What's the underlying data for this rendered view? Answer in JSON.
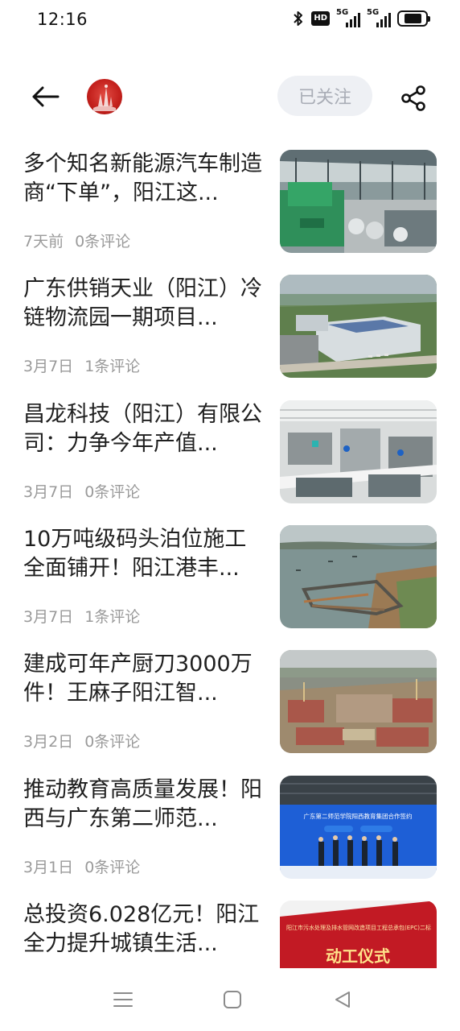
{
  "status_bar": {
    "time": "12:16",
    "icons": [
      "bluetooth-icon",
      "hd-voice-icon",
      "5g-signal-icon",
      "5g-signal-icon",
      "battery-icon"
    ],
    "hd_label": "HD",
    "signal_1_label": "5G",
    "signal_2_label": "5G",
    "battery_level": 0.7
  },
  "header": {
    "back_icon": "arrow-left-icon",
    "avatar": "publisher-logo",
    "follow_label": "已关注",
    "share_icon": "share-icon"
  },
  "news": [
    {
      "title": "多个知名新能源汽车制造商“下单”，阳江这...",
      "date": "7天前",
      "comments": "0条评论",
      "thumb": "factory-hall"
    },
    {
      "title": "广东供销天业（阳江）冷链物流园一期项目...",
      "date": "3月7日",
      "comments": "1条评论",
      "thumb": "logistics-park"
    },
    {
      "title": "昌龙科技（阳江）有限公司：力争今年产值...",
      "date": "3月7日",
      "comments": "0条评论",
      "thumb": "production-line"
    },
    {
      "title": "10万吨级码头泊位施工全面铺开！阳江港丰...",
      "date": "3月7日",
      "comments": "1条评论",
      "thumb": "port-construction"
    },
    {
      "title": "建成可年产厨刀3000万件！王麻子阳江智...",
      "date": "3月2日",
      "comments": "0条评论",
      "thumb": "construction-site"
    },
    {
      "title": "推动教育高质量发展！阳西与广东第二师范...",
      "date": "3月1日",
      "comments": "0条评论",
      "thumb": "signing-ceremony"
    },
    {
      "title": "总投资6.028亿元！阳江全力提升城镇生活...",
      "date": "",
      "comments": "",
      "thumb": "groundbreaking-banner"
    }
  ],
  "thumb_text": {
    "signing_banner": "广东第二师范学院阳西教育集团合作签约",
    "ground_banner_top": "阳江市污水处理及排水管网改造项目工程总承包(EPC)二标",
    "ground_banner_main": "动工仪式"
  },
  "nav_bar": {
    "menu_icon": "menu-icon",
    "home_icon": "home-square-icon",
    "back_icon": "back-triangle-icon"
  }
}
